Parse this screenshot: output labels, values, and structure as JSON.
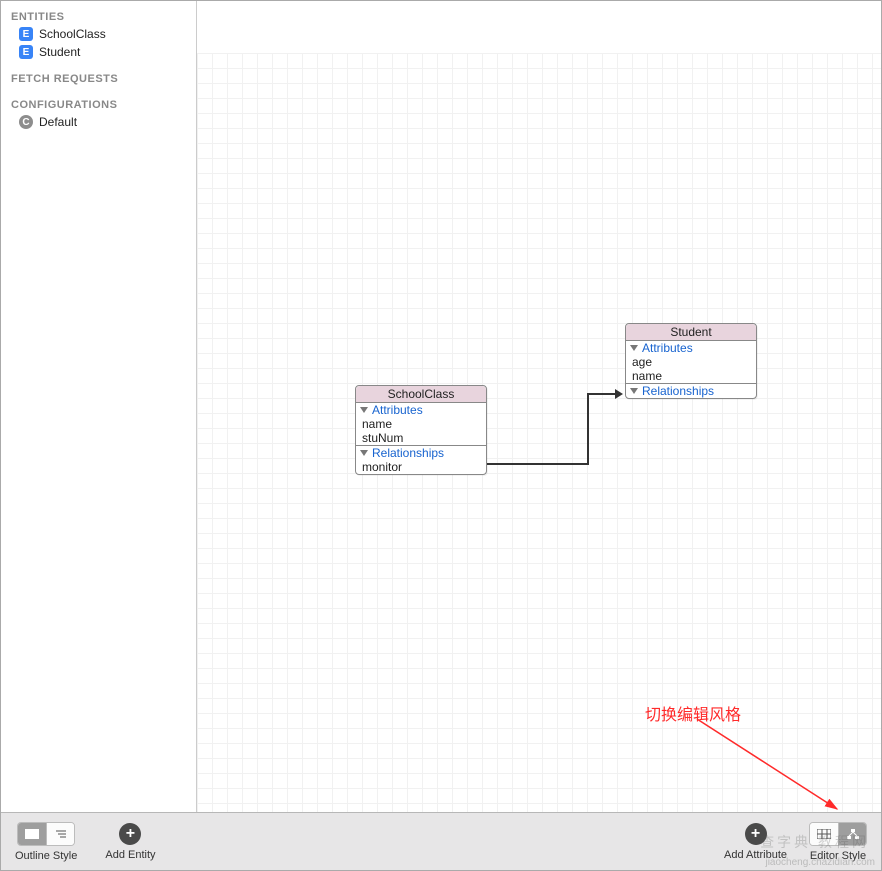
{
  "sidebar": {
    "entities_header": "ENTITIES",
    "entities": [
      "SchoolClass",
      "Student"
    ],
    "entity_badge": "E",
    "fetch_header": "FETCH REQUESTS",
    "config_header": "CONFIGURATIONS",
    "config_badge": "C",
    "configs": [
      "Default"
    ]
  },
  "diagram": {
    "entity_a": {
      "title": "SchoolClass",
      "attributes_label": "Attributes",
      "attributes": [
        "name",
        "stuNum"
      ],
      "relationships_label": "Relationships",
      "relationships": [
        "monitor"
      ]
    },
    "entity_b": {
      "title": "Student",
      "attributes_label": "Attributes",
      "attributes": [
        "age",
        "name"
      ],
      "relationships_label": "Relationships",
      "relationships": []
    }
  },
  "annotation": {
    "text": "切换编辑风格"
  },
  "toolbar": {
    "outline_style": "Outline Style",
    "add_entity": "Add Entity",
    "add_attribute": "Add Attribute",
    "editor_style": "Editor Style"
  },
  "watermark": "jiaocheng.chazidian.com",
  "watermark2": "查字典  教程网"
}
